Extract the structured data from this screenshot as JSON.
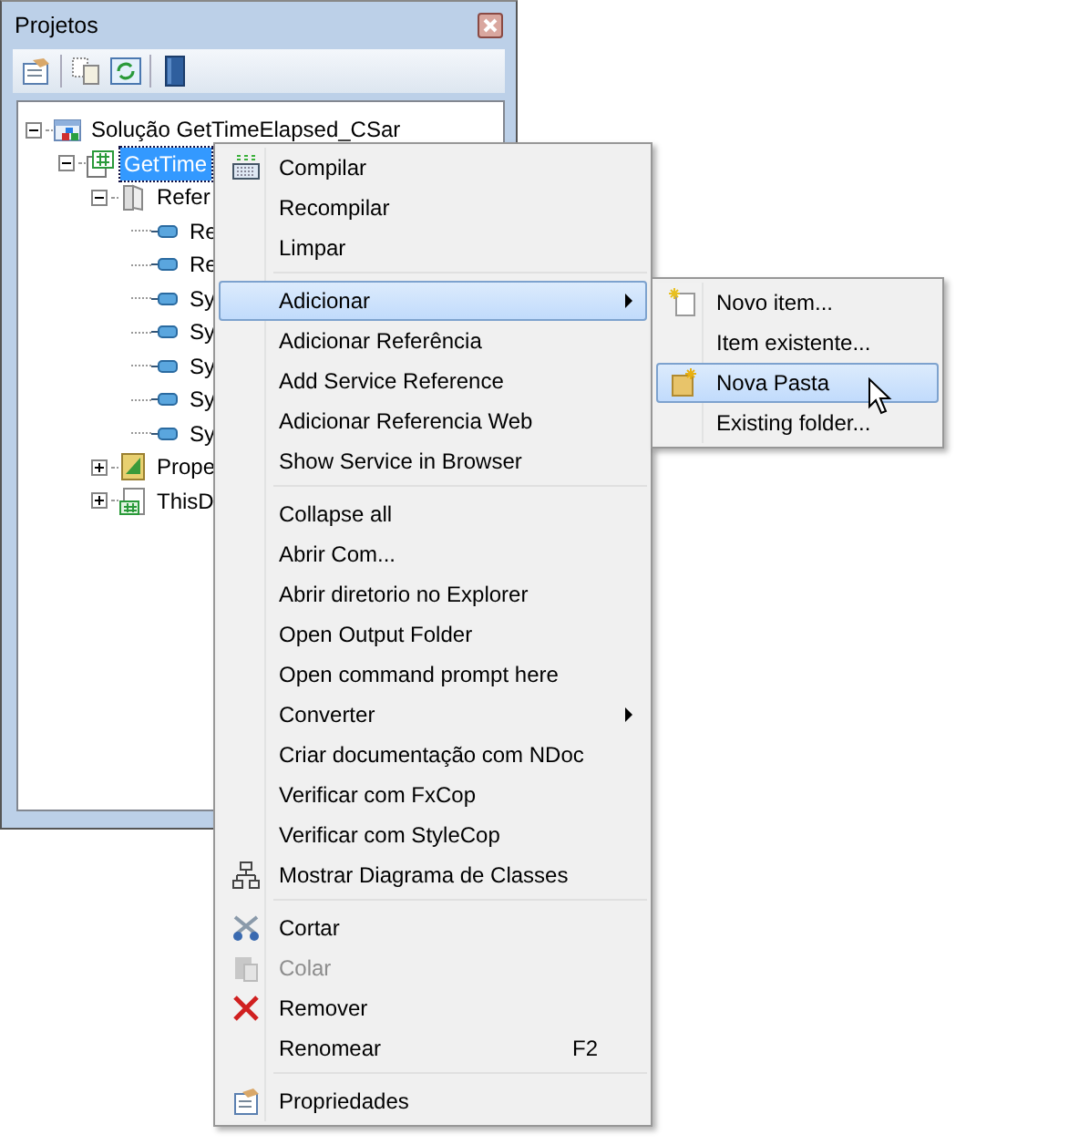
{
  "panel": {
    "title": "Projetos"
  },
  "tree": [
    {
      "label": "Solução GetTimeElapsed_CSar",
      "kind": "solution",
      "expanded": true,
      "selected": false,
      "children": [
        {
          "label": "GetTime",
          "kind": "project",
          "expanded": true,
          "selected": true,
          "children": [
            {
              "label": "Refer",
              "kind": "references",
              "expanded": true,
              "selected": false,
              "children": [
                {
                  "label": "Re",
                  "kind": "reference",
                  "selected": false
                },
                {
                  "label": "Re",
                  "kind": "reference",
                  "selected": false
                },
                {
                  "label": "Sy",
                  "kind": "reference",
                  "selected": false
                },
                {
                  "label": "Sy",
                  "kind": "reference",
                  "selected": false
                },
                {
                  "label": "Sy",
                  "kind": "reference",
                  "selected": false
                },
                {
                  "label": "Sy",
                  "kind": "reference",
                  "selected": false
                },
                {
                  "label": "Sy",
                  "kind": "reference",
                  "selected": false
                }
              ]
            },
            {
              "label": "Prope",
              "kind": "properties",
              "expanded": false,
              "selected": false
            },
            {
              "label": "ThisD",
              "kind": "code-file",
              "expanded": false,
              "selected": false
            }
          ]
        }
      ]
    }
  ],
  "context_menu": [
    {
      "kind": "item",
      "label": "Compilar",
      "selected": false,
      "disabled": false
    },
    {
      "kind": "item",
      "label": "Recompilar",
      "selected": false,
      "disabled": false
    },
    {
      "kind": "item",
      "label": "Limpar",
      "selected": false,
      "disabled": false
    },
    {
      "kind": "separator"
    },
    {
      "kind": "submenu",
      "label": "Adicionar",
      "selected": true,
      "disabled": false,
      "submenu": [
        {
          "kind": "item",
          "label": "Novo item...",
          "selected": false,
          "disabled": false
        },
        {
          "kind": "item",
          "label": "Item existente...",
          "selected": false,
          "disabled": false
        },
        {
          "kind": "item",
          "label": "Nova Pasta",
          "selected": true,
          "disabled": false
        },
        {
          "kind": "item",
          "label": "Existing folder...",
          "selected": false,
          "disabled": false
        }
      ]
    },
    {
      "kind": "item",
      "label": "Adicionar Referência",
      "selected": false,
      "disabled": false
    },
    {
      "kind": "item",
      "label": "Add Service Reference",
      "selected": false,
      "disabled": false
    },
    {
      "kind": "item",
      "label": "Adicionar Referencia Web",
      "selected": false,
      "disabled": false
    },
    {
      "kind": "item",
      "label": "Show Service in Browser",
      "selected": false,
      "disabled": false
    },
    {
      "kind": "separator"
    },
    {
      "kind": "item",
      "label": "Collapse all",
      "selected": false,
      "disabled": false
    },
    {
      "kind": "item",
      "label": "Abrir Com...",
      "selected": false,
      "disabled": false
    },
    {
      "kind": "item",
      "label": "Abrir diretorio no Explorer",
      "selected": false,
      "disabled": false
    },
    {
      "kind": "item",
      "label": "Open Output Folder",
      "selected": false,
      "disabled": false
    },
    {
      "kind": "item",
      "label": "Open command prompt here",
      "selected": false,
      "disabled": false
    },
    {
      "kind": "submenu",
      "label": "Converter",
      "selected": false,
      "disabled": false
    },
    {
      "kind": "item",
      "label": "Criar documentação com NDoc",
      "selected": false,
      "disabled": false
    },
    {
      "kind": "item",
      "label": "Verificar com FxCop",
      "selected": false,
      "disabled": false
    },
    {
      "kind": "item",
      "label": "Verificar com StyleCop",
      "selected": false,
      "disabled": false
    },
    {
      "kind": "item",
      "label": "Mostrar Diagrama de Classes",
      "selected": false,
      "disabled": false
    },
    {
      "kind": "separator"
    },
    {
      "kind": "item",
      "label": "Cortar",
      "selected": false,
      "disabled": false
    },
    {
      "kind": "item",
      "label": "Colar",
      "selected": false,
      "disabled": true
    },
    {
      "kind": "item",
      "label": "Remover",
      "selected": false,
      "disabled": false
    },
    {
      "kind": "item",
      "label": "Renomear",
      "selected": false,
      "disabled": false,
      "shortcut": "F2"
    },
    {
      "kind": "separator"
    },
    {
      "kind": "item",
      "label": "Propriedades",
      "selected": false,
      "disabled": false
    }
  ]
}
